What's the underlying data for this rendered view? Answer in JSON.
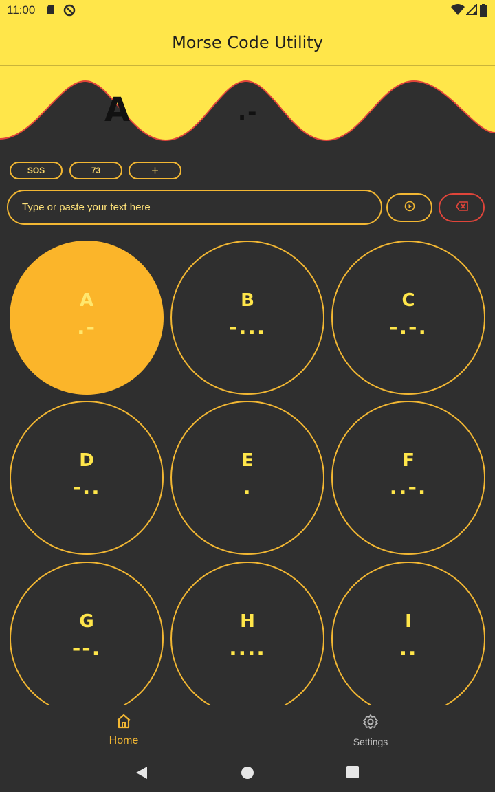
{
  "status_bar": {
    "time": "11:00",
    "icons": [
      "sd-card-icon",
      "do-not-disturb-icon",
      "wifi-icon",
      "signal-icon",
      "battery-icon"
    ]
  },
  "app_bar": {
    "title": "Morse Code Utility"
  },
  "header": {
    "letter": "A",
    "code": ".-"
  },
  "chips": [
    {
      "label": "SOS"
    },
    {
      "label": "73"
    },
    {
      "label": "+"
    }
  ],
  "input": {
    "placeholder": "Type or paste your text here"
  },
  "grid": [
    {
      "letter": "A",
      "code": ".-",
      "active": true
    },
    {
      "letter": "B",
      "code": "-...",
      "active": false
    },
    {
      "letter": "C",
      "code": "-.-.",
      "active": false
    },
    {
      "letter": "D",
      "code": "-..",
      "active": false
    },
    {
      "letter": "E",
      "code": ".",
      "active": false
    },
    {
      "letter": "F",
      "code": "..-.",
      "active": false
    },
    {
      "letter": "G",
      "code": "--.",
      "active": false
    },
    {
      "letter": "H",
      "code": "....",
      "active": false
    },
    {
      "letter": "I",
      "code": "..",
      "active": false
    }
  ],
  "bottom_nav": {
    "home_label": "Home",
    "settings_label": "Settings"
  },
  "colors": {
    "accent_yellow": "#ffe64a",
    "accent_amber": "#fbb52a",
    "outline": "#f2b733",
    "clear_red": "#e0453a",
    "background": "#2f2f2f"
  }
}
